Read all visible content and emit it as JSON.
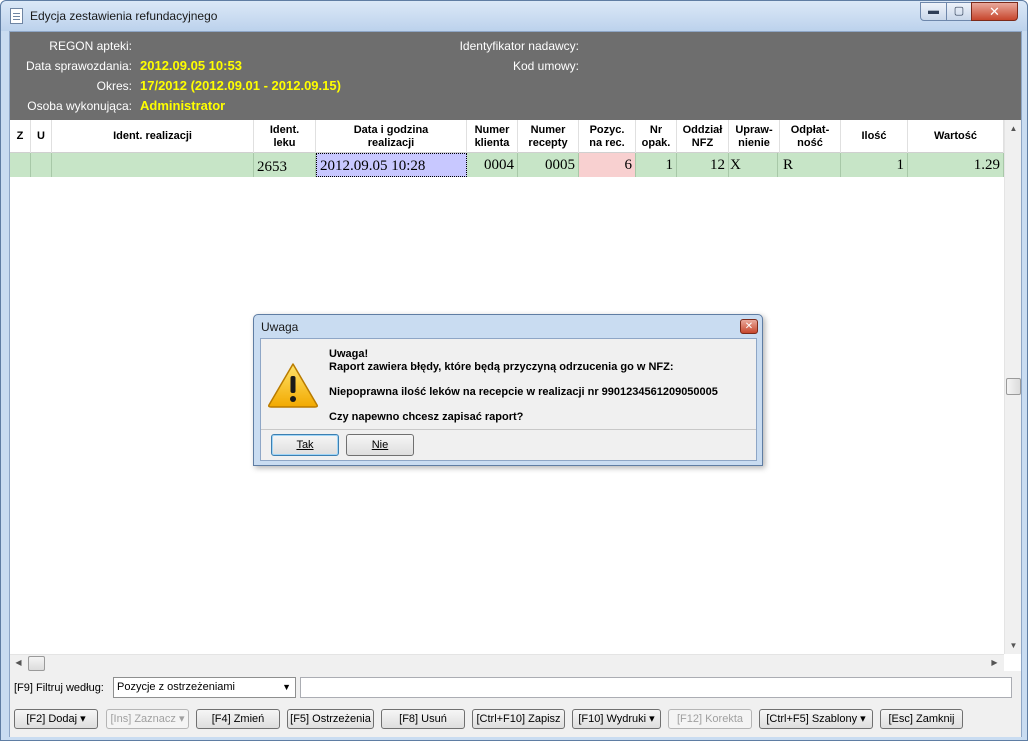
{
  "window": {
    "title": "Edycja zestawienia refundacyjnego",
    "min_glyph": "▬",
    "max_glyph": "▢",
    "close_glyph": "✕"
  },
  "header": {
    "regon_label": "REGON apteki:",
    "regon_value": "",
    "date_label": "Data sprawozdania:",
    "date_value": "2012.09.05 10:53",
    "period_label": "Okres:",
    "period_value": "17/2012 (2012.09.01 - 2012.09.15)",
    "person_label": "Osoba wykonująca:",
    "person_value": "Administrator",
    "sender_label": "Identyfikator nadawcy:",
    "sender_value": "",
    "contract_label": "Kod umowy:",
    "contract_value": ""
  },
  "grid": {
    "columns": [
      "Z",
      "U",
      "Ident. realizacji",
      "Ident. leku",
      "Data i godzina realizacji",
      "Numer klienta",
      "Numer recepty",
      "Pozyc. na rec.",
      "Nr opak.",
      "Oddział NFZ",
      "Upraw-nienie",
      "Odpłat-ność",
      "Ilość",
      "Wartość"
    ],
    "rows": [
      [
        "",
        "",
        "",
        "2653",
        "2012.09.05 10:28",
        "0004",
        "0005",
        "6",
        "1",
        "12",
        "X",
        "R",
        "1",
        "1.29"
      ]
    ]
  },
  "filter": {
    "label": "[F9] Filtruj według:",
    "selected": "Pozycje z ostrzeżeniami",
    "text_value": ""
  },
  "toolbar": {
    "buttons": [
      "[F2] Dodaj ▾",
      "[Ins] Zaznacz ▾",
      "[F4] Zmień",
      "[F5] Ostrzeżenia",
      "[F8] Usuń",
      "[Ctrl+F10] Zapisz",
      "[F10] Wydruki ▾",
      "[F12] Korekta",
      "[Ctrl+F5] Szablony ▾",
      "[Esc] Zamknij"
    ]
  },
  "dialog": {
    "title": "Uwaga",
    "close_glyph": "✕",
    "heading": "Uwaga!",
    "line1": "Raport zawiera błędy, które będą przyczyną odrzucenia go w NFZ:",
    "line2": "Niepoprawna ilość leków na recepcie w realizacji nr 9901234561209050005",
    "line3": "Czy napewno chcesz zapisać raport?",
    "yes_label": "Tak",
    "no_label": "Nie",
    "icon": "warning-icon"
  },
  "colors": {
    "header_bg": "#6e6e6e",
    "header_value": "#ffff00",
    "row_bg": "#c7e5c7",
    "date_cell_bg": "#c8c8ff",
    "pos_cell_bg": "#f8d0d0"
  }
}
